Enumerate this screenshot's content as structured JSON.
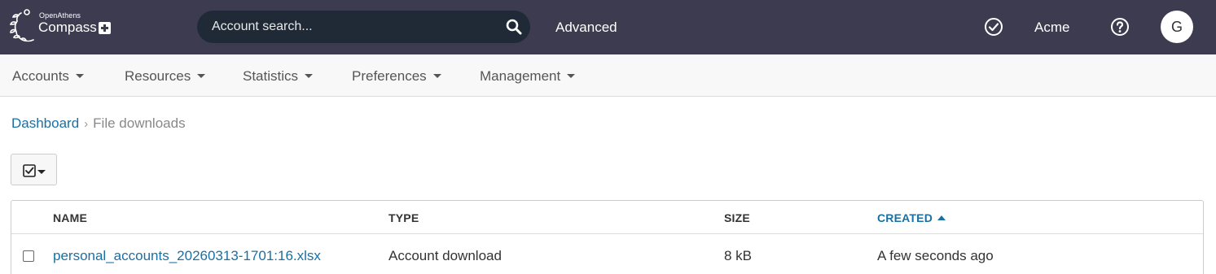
{
  "header": {
    "brand_small": "OpenAthens",
    "brand_main": "Compass",
    "search_placeholder": "Account search...",
    "advanced_label": "Advanced",
    "org_name": "Acme",
    "avatar_initial": "G",
    "icons": [
      "search-icon",
      "check-circle-icon",
      "help-icon"
    ],
    "colors": {
      "bar": "#3d3b4f",
      "search_bg": "#1f2a36"
    }
  },
  "nav": {
    "items": [
      "Accounts",
      "Resources",
      "Statistics",
      "Preferences",
      "Management"
    ]
  },
  "breadcrumb": {
    "home": "Dashboard",
    "current": "File downloads"
  },
  "table": {
    "columns": [
      "NAME",
      "TYPE",
      "SIZE",
      "CREATED"
    ],
    "sorted_column": "CREATED",
    "sort_direction": "ascending",
    "rows": [
      {
        "name": "personal_accounts_20260313-1701:16.xlsx",
        "type": "Account download",
        "size": "8 kB",
        "created": "A few seconds ago"
      }
    ]
  },
  "colors": {
    "link": "#1a6fa3"
  }
}
